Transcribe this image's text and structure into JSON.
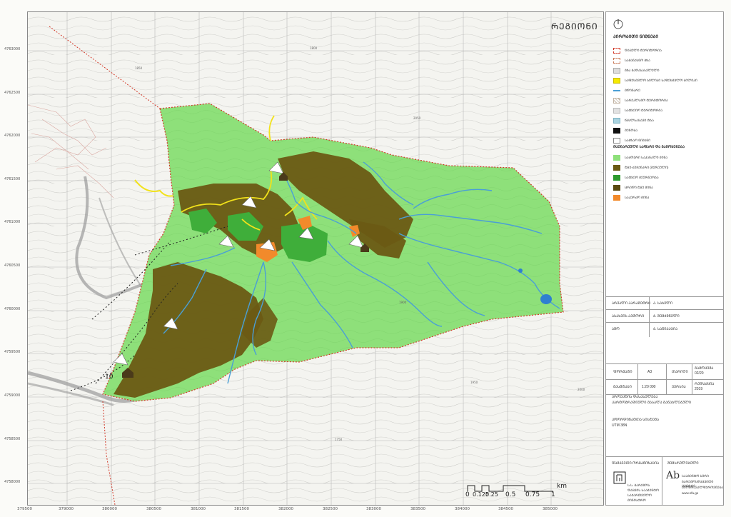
{
  "map": {
    "title": "ᲠᲔᲒᲘᲝᲜᲘ",
    "north_arrow": "north-arrow-icon",
    "contour_labels": [
      "1800",
      "1850",
      "1900",
      "1950",
      "2000",
      "2050",
      "1750"
    ],
    "y_ticks": [
      "4763000",
      "4762500",
      "4762000",
      "4761500",
      "4761000",
      "4760500",
      "4760000",
      "4759500",
      "4759000",
      "4758500",
      "4758000"
    ],
    "x_ticks": [
      "379500",
      "379000",
      "380000",
      "380500",
      "381000",
      "381500",
      "382000",
      "382500",
      "383000",
      "383500",
      "384000",
      "384500",
      "385000"
    ],
    "labels": [
      "10"
    ],
    "colors": {
      "light_green": "#8ee07a",
      "dark_olive": "#6b5a14",
      "medium_green": "#3fae3a",
      "orange": "#f28a2b",
      "river": "#4a9fd6",
      "boundary": "#d23a2a",
      "road": "#9a9a9a",
      "yellow_path": "#f2e21a"
    }
  },
  "legend": {
    "heading": "ᲞᲘᲠᲝᲑᲘᲗᲘ ᲜᲘᲨᲜᲔᲑᲘ",
    "items": [
      {
        "label": "ᲓᲐᲪᲣᲚᲘ ᲢᲔᲠᲘᲢᲝᲠᲘᲐ",
        "color": "#ffffff",
        "border": "#d23a2a"
      },
      {
        "label": "ᲡᲐᲛᲐᲜᲥᲐᲜᲝ ᲒᲖᲐ",
        "color": "#ffffff",
        "border": "#c97b5a"
      },
      {
        "label": "ᲒᲖᲐ ᲒᲐᲓᲐᲡᲐᲡᲕᲚᲔᲚᲘ",
        "color": "#dddddd",
        "border": "#aaaaaa"
      },
      {
        "label": "ᲡᲐᲤᲔᲮᲛᲕᲚᲝ ᲑᲘᲚᲘᲙᲘ ᲡᲐᲤᲔᲮᲛᲕᲚᲝ ᲑᲘᲚᲘᲙᲘ",
        "color": "#f5ea00",
        "border": "#c9b900"
      },
      {
        "label": "ᲛᲓᲘᲜᲐᲠᲔ",
        "color": "#4a9fd6",
        "border": "#4a9fd6"
      },
      {
        "label": "ᲡᲐᲠᲔᲙᲚᲐᲛᲝ ᲢᲔᲠᲘᲢᲝᲠᲘᲐ",
        "color": "#ffffff",
        "border": "#c4b6a6"
      },
      {
        "label": "ᲡᲐᲢᲧᲔᲘᲝ ᲢᲔᲠᲘᲢᲝᲠᲘᲐ",
        "color": "#e2e2e2",
        "border": "#bbbbbb"
      },
      {
        "label": "ᲬᲧᲐᲚᲡᲐᲪᲐᲕᲘ ᲢᲑᲐ",
        "color": "#a9d3e0",
        "border": "#7fb2c2"
      },
      {
        "label": "ᲨᲔᲜᲝᲑᲐ",
        "color": "#111111",
        "border": "#111111"
      },
      {
        "label": "ᲡᲐᲒᲖᲐᲝ ᲜᲘᲨᲐᲜᲘ",
        "color": "#ffffff",
        "border": "#888888"
      }
    ],
    "sub_heading": "ᲛᲪᲔᲜᲐᲠᲔᲣᲚᲘ ᲡᲐᲤᲐᲠᲘ ᲓᲐ ᲒᲐᲛᲝᲧᲔᲜᲔᲑᲐ",
    "sub_items": [
      {
        "label": "ᲡᲐᲫᲝᲕᲠᲘ ᲡᲐᲙᲐᲜᲐᲚᲘ ᲛᲘᲬᲐ",
        "color": "#8ee07a"
      },
      {
        "label": "ᲢᲧᲔ-ᲑᲣᲩᲥᲜᲐᲠᲘ (ᲨᲔᲠᲔᲣᲚᲘ)",
        "color": "#6b5a14"
      },
      {
        "label": "ᲡᲐᲢᲧᲔᲝ ᲛᲔᲣᲠᲜᲔᲝᲑᲐ",
        "color": "#2e9a2e"
      },
      {
        "label": "ᲪᲠᲘᲓᲘ ᲢᲧᲔ ᲛᲘᲬᲐ",
        "color": "#5a4a10"
      },
      {
        "label": "ᲡᲐᲙᲔᲠᲫᲝ ᲛᲘᲬᲐ",
        "color": "#f28a2b"
      }
    ]
  },
  "info_table": {
    "rows": [
      [
        "ᲐᲠᲔᲐᲚᲘ ᲞᲐᲠᲐᲛᲔᲢᲠᲘ",
        "Ა. ᲡᲐᲮᲔᲚᲘ"
      ],
      [
        "ᲐᲡᲐᲮᲕᲘᲡ ᲐᲕᲢᲝᲠᲘ",
        "Ბ. ᲨᲔᲛᲥᲛᲜᲔᲚᲘ"
      ],
      [
        "ᲐᲨᲝ",
        "Ბ. ᲡᲐᲜᲘᲙᲐᲪᲘᲐ"
      ]
    ],
    "sheet": {
      "label1": "ᲤᲝᲠᲛᲐᲢᲘ",
      "value1": "A3",
      "label2": "ᲗᲐᲠᲘᲦᲘ",
      "value2": "ᲒᲐᲛᲝᲪᲔᲛᲐ 02/20"
    },
    "scale": {
      "label1": "ᲛᲐᲡᲨᲢᲐᲑᲘ",
      "value1": "1:20 000",
      "label2": "ᲕᲔᲠᲡᲘᲐ",
      "value2": "ᲠᲔᲓᲐᲥᲪᲘᲐ 2019"
    },
    "notes": [
      "ᲞᲠᲝᲔᲥᲢᲘᲡ ᲓᲐᲡᲐᲮᲔᲚᲔᲑᲐ",
      "ᲙᲐᲠᲢᲝᲒᲠᲐᲤᲘᲣᲚᲘ ᲛᲐᲡᲐᲚᲐ ᲒᲐᲜᲐᲮᲚᲔᲑᲣᲚᲘ",
      "ᲙᲝᲝᲠᲓᲘᲜᲐᲢᲗᲐ ᲡᲘᲡᲢᲔᲛᲐ",
      "UTM 38N"
    ],
    "org_left": {
      "title": "ᲓᲐᲛᲙᲕᲔᲗᲘ ᲝᲠᲒᲐᲜᲘᲖᲐᲪᲘᲐ",
      "lines": [
        "Ს.Ს. ᲒᲐᲠᲔᲛᲝᲡ",
        "ᲓᲐᲪᲕᲘᲡ ᲡᲐᲐᲒᲔᲜᲢᲝ",
        "ᲡᲐᲥᲐᲠᲗᲕᲔᲚᲝ ᲛᲘᲜᲘᲡᲢᲠᲝ"
      ]
    },
    "org_right": {
      "title": "ᲨᲔᲛᲡᲠᲣᲚᲔᲑᲔᲚᲘ",
      "lines": [
        "ᲡᲐᲐᲒᲔᲜᲢᲝ ᲡᲣᲠᲘ",
        "ᲒᲐᲠᲔᲛᲝᲡᲓᲐᲪᲕᲘᲗᲘ ᲪᲔᲜᲢᲠᲘ",
        "ᲑᲘᲝᲛᲠᲐᲕᲐᲚᲤᲔᲠᲝᲕᲜᲔᲑᲐ",
        "www.nfa.ge"
      ]
    },
    "logo_text": "Ab"
  },
  "scalebar": {
    "labels": [
      "0",
      "0.125",
      "0.25",
      "0.5",
      "0.75",
      "1"
    ],
    "unit": "km"
  }
}
